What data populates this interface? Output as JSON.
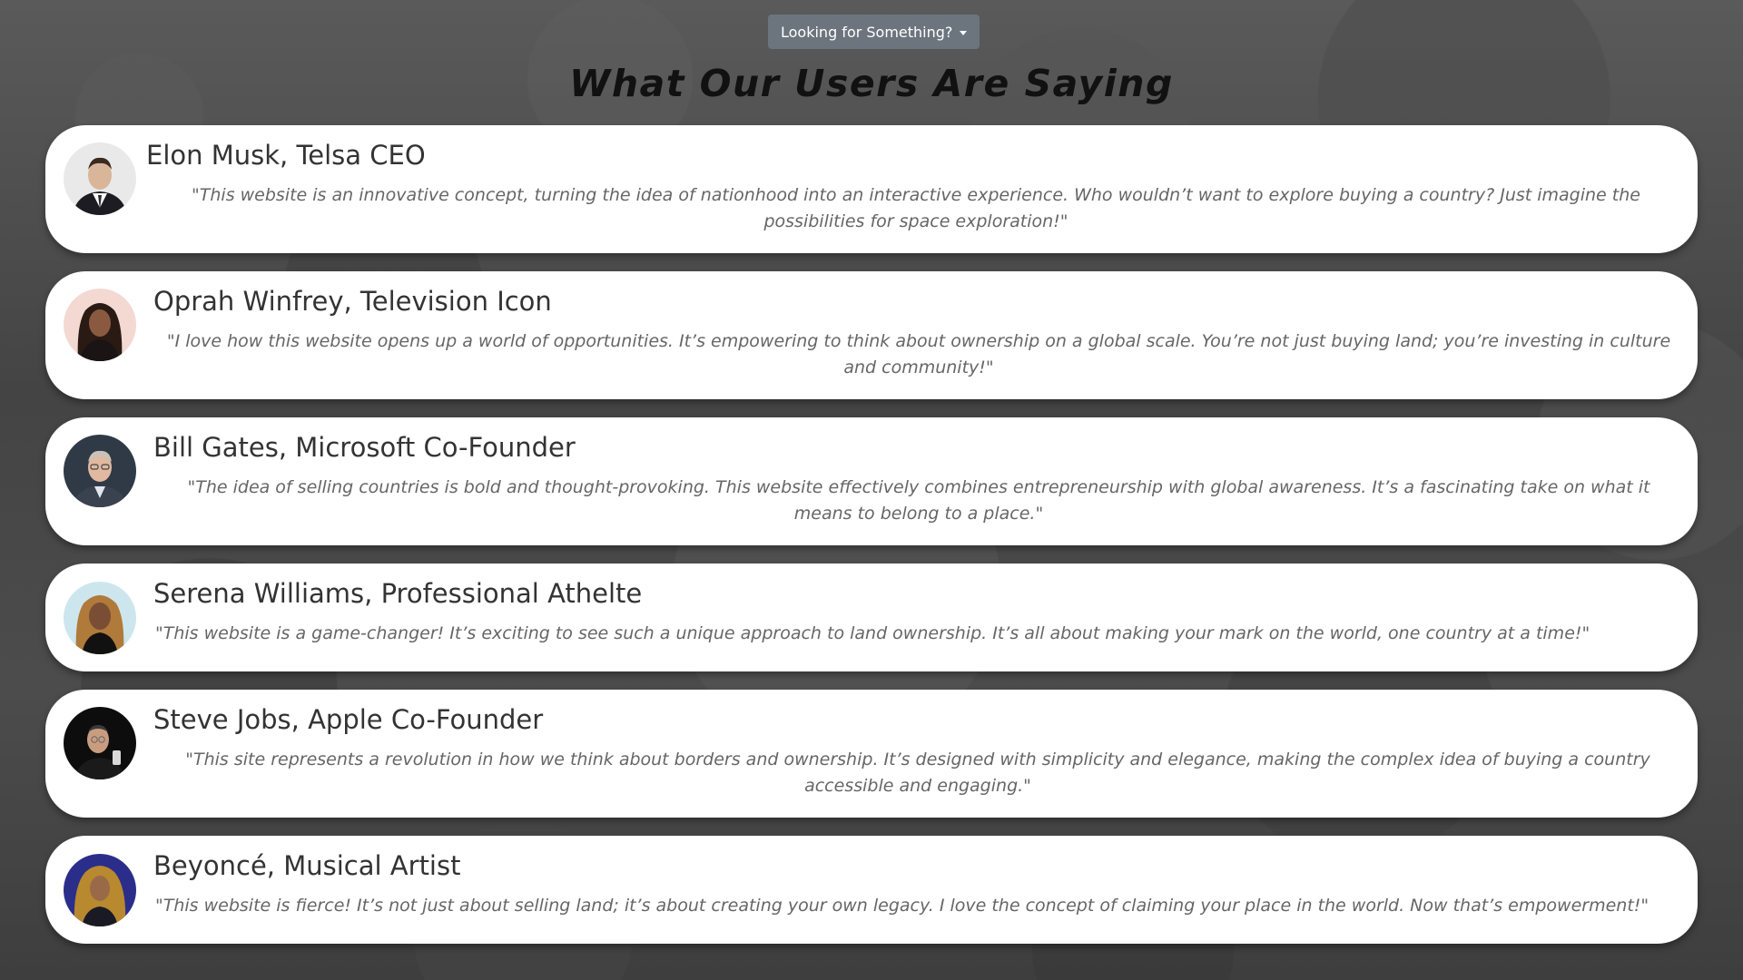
{
  "header": {
    "dropdown_label": "Looking for Something?",
    "title": "What Our Users Are Saying"
  },
  "testimonials": [
    {
      "name": "Elon Musk, Telsa CEO",
      "quote": "\"This website is an innovative concept, turning the idea of nationhood into an interactive experience. Who wouldn’t want to explore buying a country? Just imagine the possibilities for space exploration!\""
    },
    {
      "name": "Oprah Winfrey, Television Icon",
      "quote": "\"I love how this website opens up a world of opportunities. It’s empowering to think about ownership on a global scale. You’re not just buying land; you’re investing in culture and community!\""
    },
    {
      "name": "Bill Gates, Microsoft Co-Founder",
      "quote": "\"The idea of selling countries is bold and thought-provoking. This website effectively combines entrepreneurship with global awareness. It’s a fascinating take on what it means to belong to a place.\""
    },
    {
      "name": "Serena Williams, Professional Athelte",
      "quote": "\"This website is a game-changer! It’s exciting to see such a unique approach to land ownership. It’s all about making your mark on the world, one country at a time!\""
    },
    {
      "name": "Steve Jobs, Apple Co-Founder",
      "quote": "\"This site represents a revolution in how we think about borders and ownership. It’s designed with simplicity and elegance, making the complex idea of buying a country accessible and engaging.\""
    },
    {
      "name": "Beyoncé, Musical Artist",
      "quote": "\"This website is fierce! It’s not just about selling land; it’s about creating your own legacy. I love the concept of claiming your place in the world. Now that’s empowerment!\""
    }
  ],
  "colors": {
    "dropdown_bg": "#6c757d",
    "card_bg": "#ffffff",
    "name_text": "#333333",
    "quote_text": "#666666"
  }
}
